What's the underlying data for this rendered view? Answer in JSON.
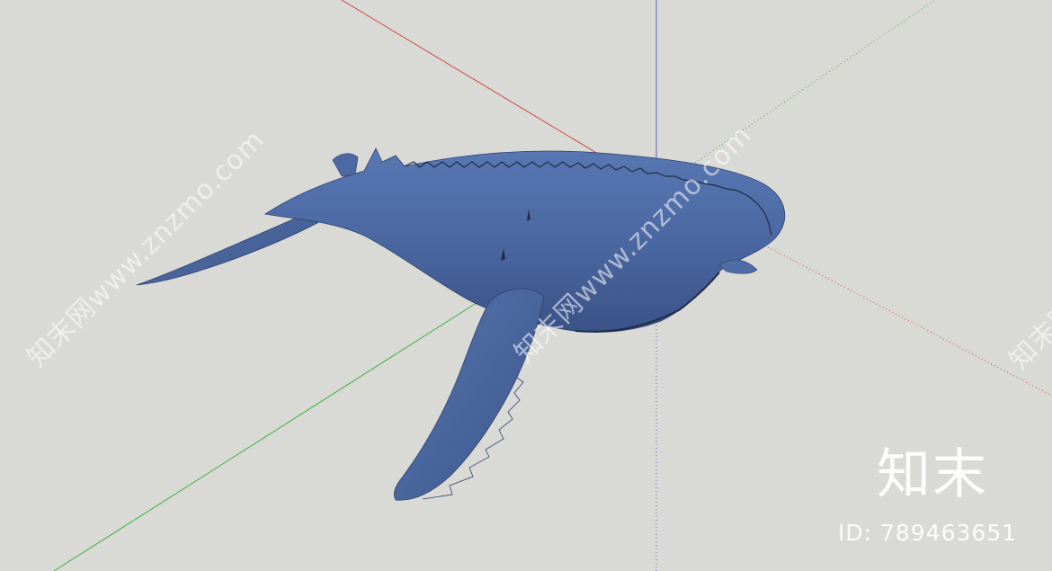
{
  "viewport": {
    "background_color": "#d9d9d6",
    "axis_colors": {
      "red": "#c94a4a",
      "green": "#43b043",
      "blue": "#5a63b8"
    }
  },
  "model": {
    "name": "humpback-whale",
    "body_color": "#4a66a0"
  },
  "watermark": {
    "diagonal_text": "知末网www.znzmo.com",
    "logo_text": "知末",
    "id_text": "ID: 789463651"
  }
}
